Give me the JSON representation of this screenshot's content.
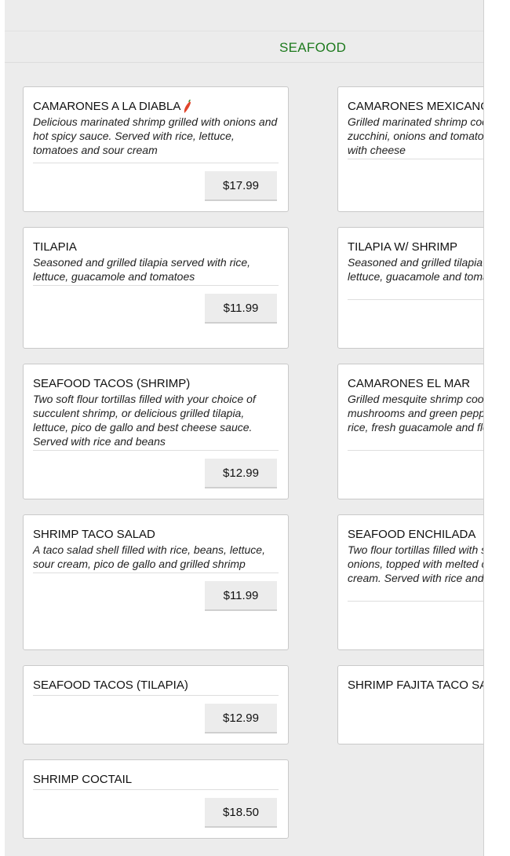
{
  "category": {
    "title": "SEAFOOD"
  },
  "items": [
    {
      "name": "CAMARONES A LA DIABLA",
      "spicy": true,
      "description": "Delicious marinated shrimp grilled with onions and hot spicy sauce. Served with rice, lettuce, tomatoes and sour cream",
      "price": "$17.99"
    },
    {
      "name": "CAMARONES MEXICANOS",
      "description": "Grilled marinated shrimp cooked with green zucchini, onions and tomatoes on a bed of rice with cheese",
      "price": ""
    },
    {
      "name": "TILAPIA",
      "description": "Seasoned and grilled tilapia served with rice, lettuce, guacamole and tomatoes",
      "price": "$11.99"
    },
    {
      "name": "TILAPIA W/ SHRIMP",
      "description": "Seasoned and grilled tilapia served with rice, lettuce, guacamole and tomatoes with shrimp",
      "price": ""
    },
    {
      "name": "SEAFOOD TACOS (SHRIMP)",
      "description": "Two soft flour tortillas filled with your choice of succulent shrimp, or delicious grilled tilapia, lettuce, pico de gallo and best cheese sauce. Served with rice and beans",
      "price": "$12.99"
    },
    {
      "name": "CAMARONES EL MAR",
      "description": "Grilled mesquite shrimp cooked with onions, mushrooms and green peppers. Served with rice, fresh guacamole and flour tortillas",
      "price": ""
    },
    {
      "name": "SHRIMP TACO SALAD",
      "description": "A taco salad shell filled with rice, beans, lettuce, sour cream, pico de gallo and grilled shrimp",
      "price": "$11.99"
    },
    {
      "name": "SEAFOOD ENCHILADA",
      "description": "Two flour tortillas filled with shrimp and sautéed onions, topped with melted cheese and sour cream. Served with rice and beans",
      "price": ""
    },
    {
      "name": "SEAFOOD TACOS (TILAPIA)",
      "description": "",
      "price": "$12.99"
    },
    {
      "name": "SHRIMP FAJITA TACO SALAD",
      "description": "",
      "price": ""
    },
    {
      "name": "SHRIMP COCTAIL",
      "description": "",
      "price": "$18.50"
    }
  ],
  "colors": {
    "category_title": "#1e7a1e",
    "page_bg": "#ececec",
    "card_bg": "#ffffff",
    "price_bg": "#ececec"
  },
  "icons": {
    "spicy": "chili-pepper-icon"
  }
}
